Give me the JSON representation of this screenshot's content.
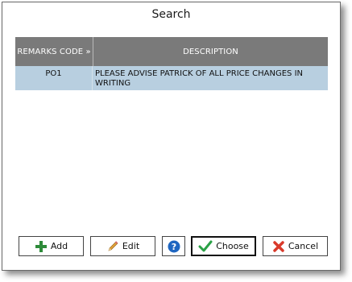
{
  "window": {
    "title": "Search"
  },
  "grid": {
    "columns": [
      "REMARKS CODE »",
      "DESCRIPTION"
    ],
    "rows": [
      {
        "code": "PO1",
        "description": "PLEASE ADVISE PATRICK OF ALL PRICE CHANGES IN WRITING"
      }
    ]
  },
  "buttons": {
    "add": {
      "label": "Add",
      "icon": "plus-icon",
      "color": "#2e8b3a"
    },
    "edit": {
      "label": "Edit",
      "icon": "pencil-icon",
      "color": "#e2a23a"
    },
    "help": {
      "icon": "question-icon",
      "color": "#1f66c1"
    },
    "choose": {
      "label": "Choose",
      "icon": "checkmark-icon",
      "color": "#2aa146"
    },
    "cancel": {
      "label": "Cancel",
      "icon": "x-icon",
      "color": "#d93a2b"
    }
  }
}
